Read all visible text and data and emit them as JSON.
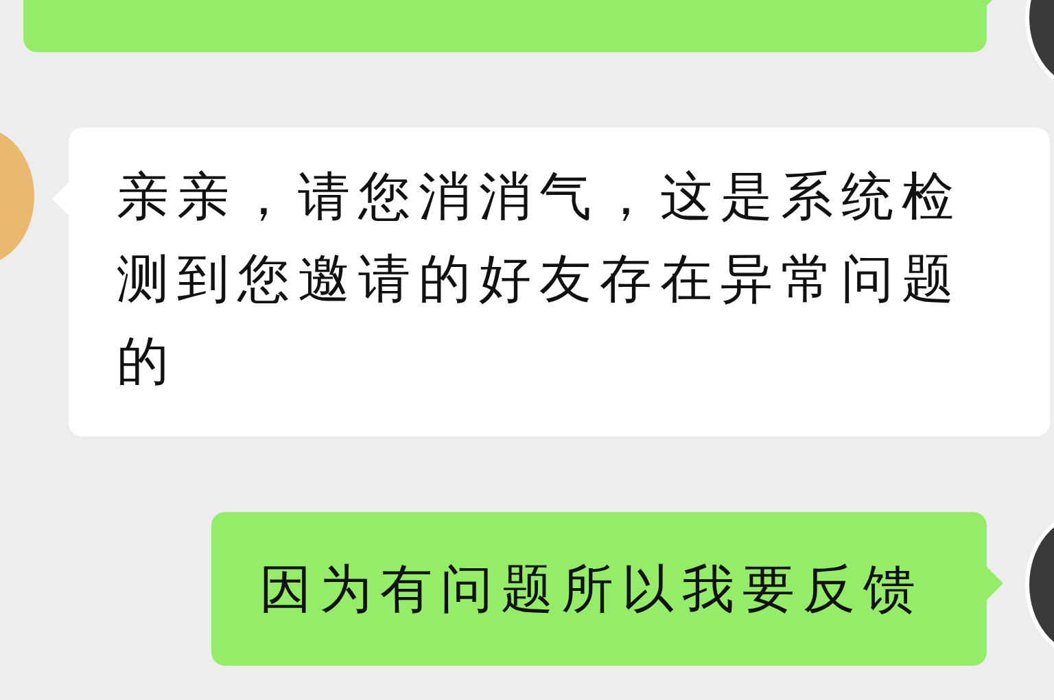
{
  "messages": [
    {
      "kind": "outgoing"
    },
    {
      "kind": "incoming",
      "text": "亲亲，请您消消气，这是系统检测到您邀请的好友存在异常问题的"
    },
    {
      "kind": "outgoing",
      "text": "因为有问题所以我要反馈"
    }
  ]
}
